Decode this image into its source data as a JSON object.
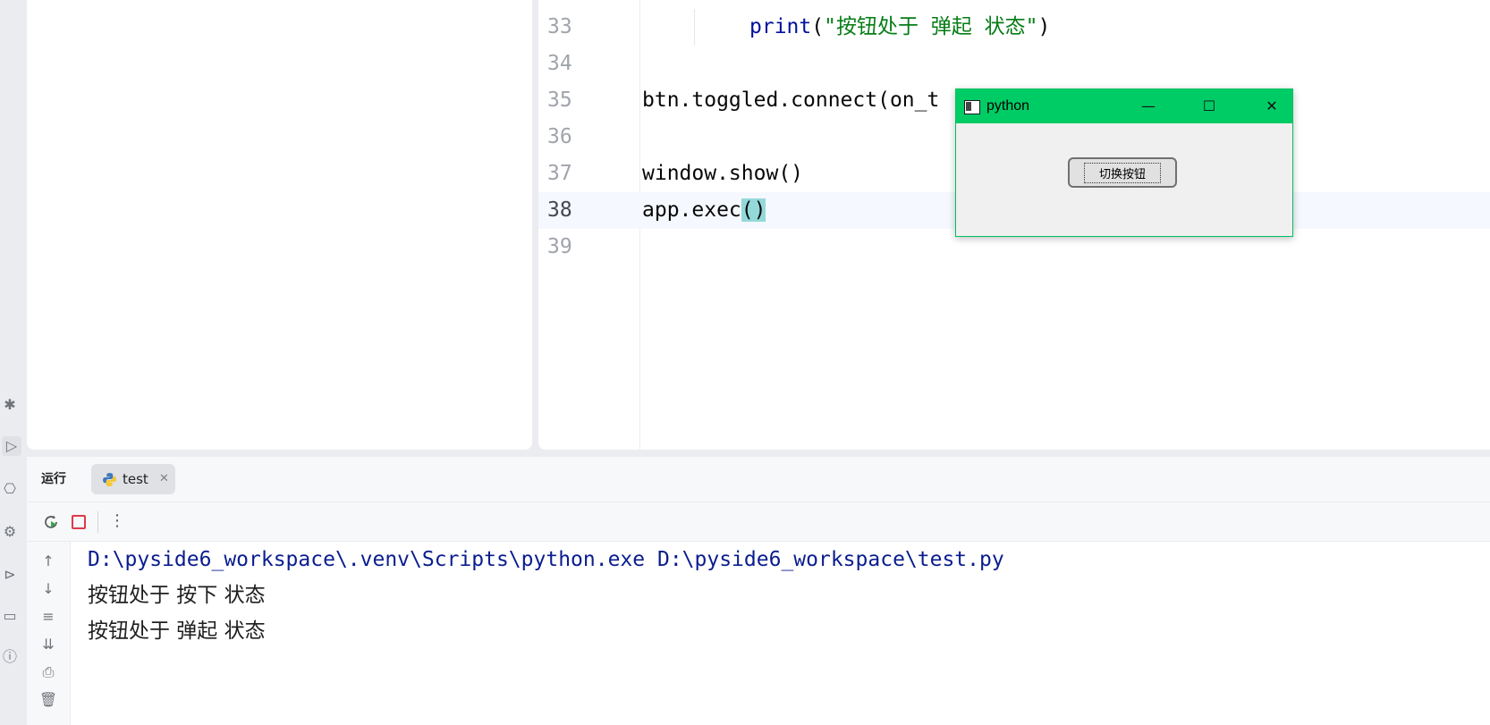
{
  "editor": {
    "lines": [
      {
        "num": "33",
        "fn": "print",
        "open": "(",
        "str": "\"按钮处于 弹起 状态\"",
        "close": ")"
      },
      {
        "num": "34",
        "text": ""
      },
      {
        "num": "35",
        "text": "btn.toggled.connect(on_t"
      },
      {
        "num": "36",
        "text": ""
      },
      {
        "num": "37",
        "text": "window.show()"
      },
      {
        "num": "38",
        "pre": "app.exec",
        "hl": "()"
      },
      {
        "num": "39",
        "text": ""
      }
    ]
  },
  "popup": {
    "title": "python",
    "minimize": "—",
    "maximize": "☐",
    "close": "✕",
    "button_label": "切换按钮"
  },
  "run": {
    "label": "运行",
    "tab_name": "test",
    "tab_close": "✕",
    "more": "⋮",
    "output": [
      "D:\\pyside6_workspace\\.venv\\Scripts\\python.exe D:\\pyside6_workspace\\test.py",
      "按钮处于 按下 状态",
      "按钮处于 弹起 状态"
    ]
  },
  "icons": {
    "left_strip": [
      "debug-icon",
      "run-icon",
      "python-packages-icon",
      "services-icon",
      "run-configurations-icon",
      "terminal-icon",
      "problems-icon"
    ],
    "console_gutter": [
      "scroll-up-icon",
      "scroll-down-icon",
      "soft-wrap-icon",
      "scroll-to-end-icon",
      "print-icon",
      "clear-icon"
    ]
  },
  "colors": {
    "accent_green": "#00cc66",
    "string_green": "#067d17",
    "function_blue": "#00109c",
    "console_path_blue": "#0a1d8f",
    "stop_red": "#db3b4b",
    "paren_highlight": "#93d9d9"
  }
}
